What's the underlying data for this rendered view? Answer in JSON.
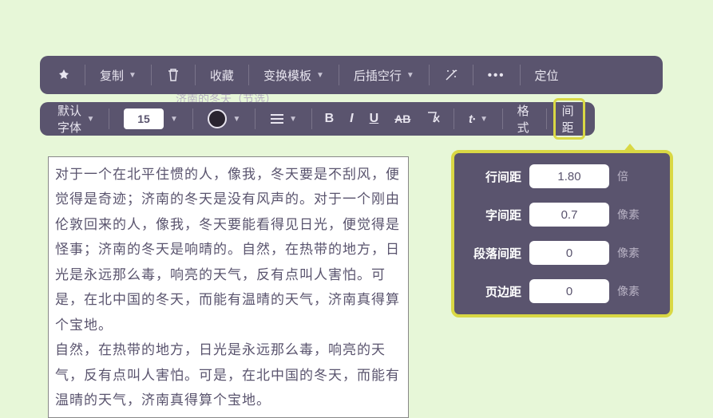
{
  "toolbar1": {
    "copy": "复制",
    "favorite": "收藏",
    "changeTemplate": "变换模板",
    "insertBlankLine": "后插空行",
    "locate": "定位"
  },
  "toolbar2": {
    "defaultFont": "默认字体",
    "fontSize": "15",
    "bold": "B",
    "italic": "I",
    "underline": "U",
    "allcaps": "AB",
    "format": "格式",
    "spacing": "间距"
  },
  "hiddenText": "济南的冬天（节选）",
  "editor": {
    "p1": "对于一个在北平住惯的人，像我，冬天要是不刮风，便觉得是奇迹；济南的冬天是没有风声的。对于一个刚由伦敦回来的人，像我，冬天要能看得见日光，便觉得是怪事；济南的冬天是响晴的。自然，在热带的地方，日光是永远那么毒，响亮的天气，反有点叫人害怕。可是，在北中国的冬天，而能有温晴的天气，济南真得算个宝地。",
    "p2": "自然，在热带的地方，日光是永远那么毒，响亮的天气，反有点叫人害怕。可是，在北中国的冬天，而能有温晴的天气，济南真得算个宝地。"
  },
  "panel": {
    "lineSpacing": {
      "label": "行间距",
      "value": "1.80",
      "unit": "倍"
    },
    "letterSpacing": {
      "label": "字间距",
      "value": "0.7",
      "unit": "像素"
    },
    "paraSpacing": {
      "label": "段落间距",
      "value": "0",
      "unit": "像素"
    },
    "pageMargin": {
      "label": "页边距",
      "value": "0",
      "unit": "像素"
    }
  }
}
